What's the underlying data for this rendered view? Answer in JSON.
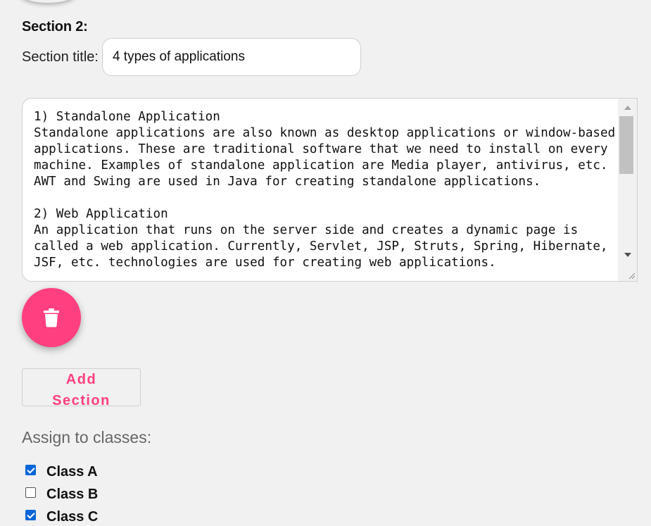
{
  "section": {
    "heading": "Section 2:",
    "title_label": "Section title:",
    "title_value": "4 types of applications",
    "content": "1) Standalone Application\nStandalone applications are also known as desktop applications or window-based applications. These are traditional software that we need to install on every machine. Examples of standalone application are Media player, antivirus, etc. AWT and Swing are used in Java for creating standalone applications.\n\n2) Web Application\nAn application that runs on the server side and creates a dynamic page is called a web application. Currently, Servlet, JSP, Struts, Spring, Hibernate, JSF, etc. technologies are used for creating web applications."
  },
  "actions": {
    "delete_icon": "trash-icon",
    "add_section_label": "Add Section"
  },
  "assign": {
    "label": "Assign to classes:",
    "classes": [
      {
        "label": "Class A",
        "checked": true
      },
      {
        "label": "Class B",
        "checked": false
      },
      {
        "label": "Class C",
        "checked": true
      }
    ]
  },
  "colors": {
    "accent": "#ff3f80",
    "checkbox": "#0a66d8",
    "background": "#f1f1f1"
  }
}
